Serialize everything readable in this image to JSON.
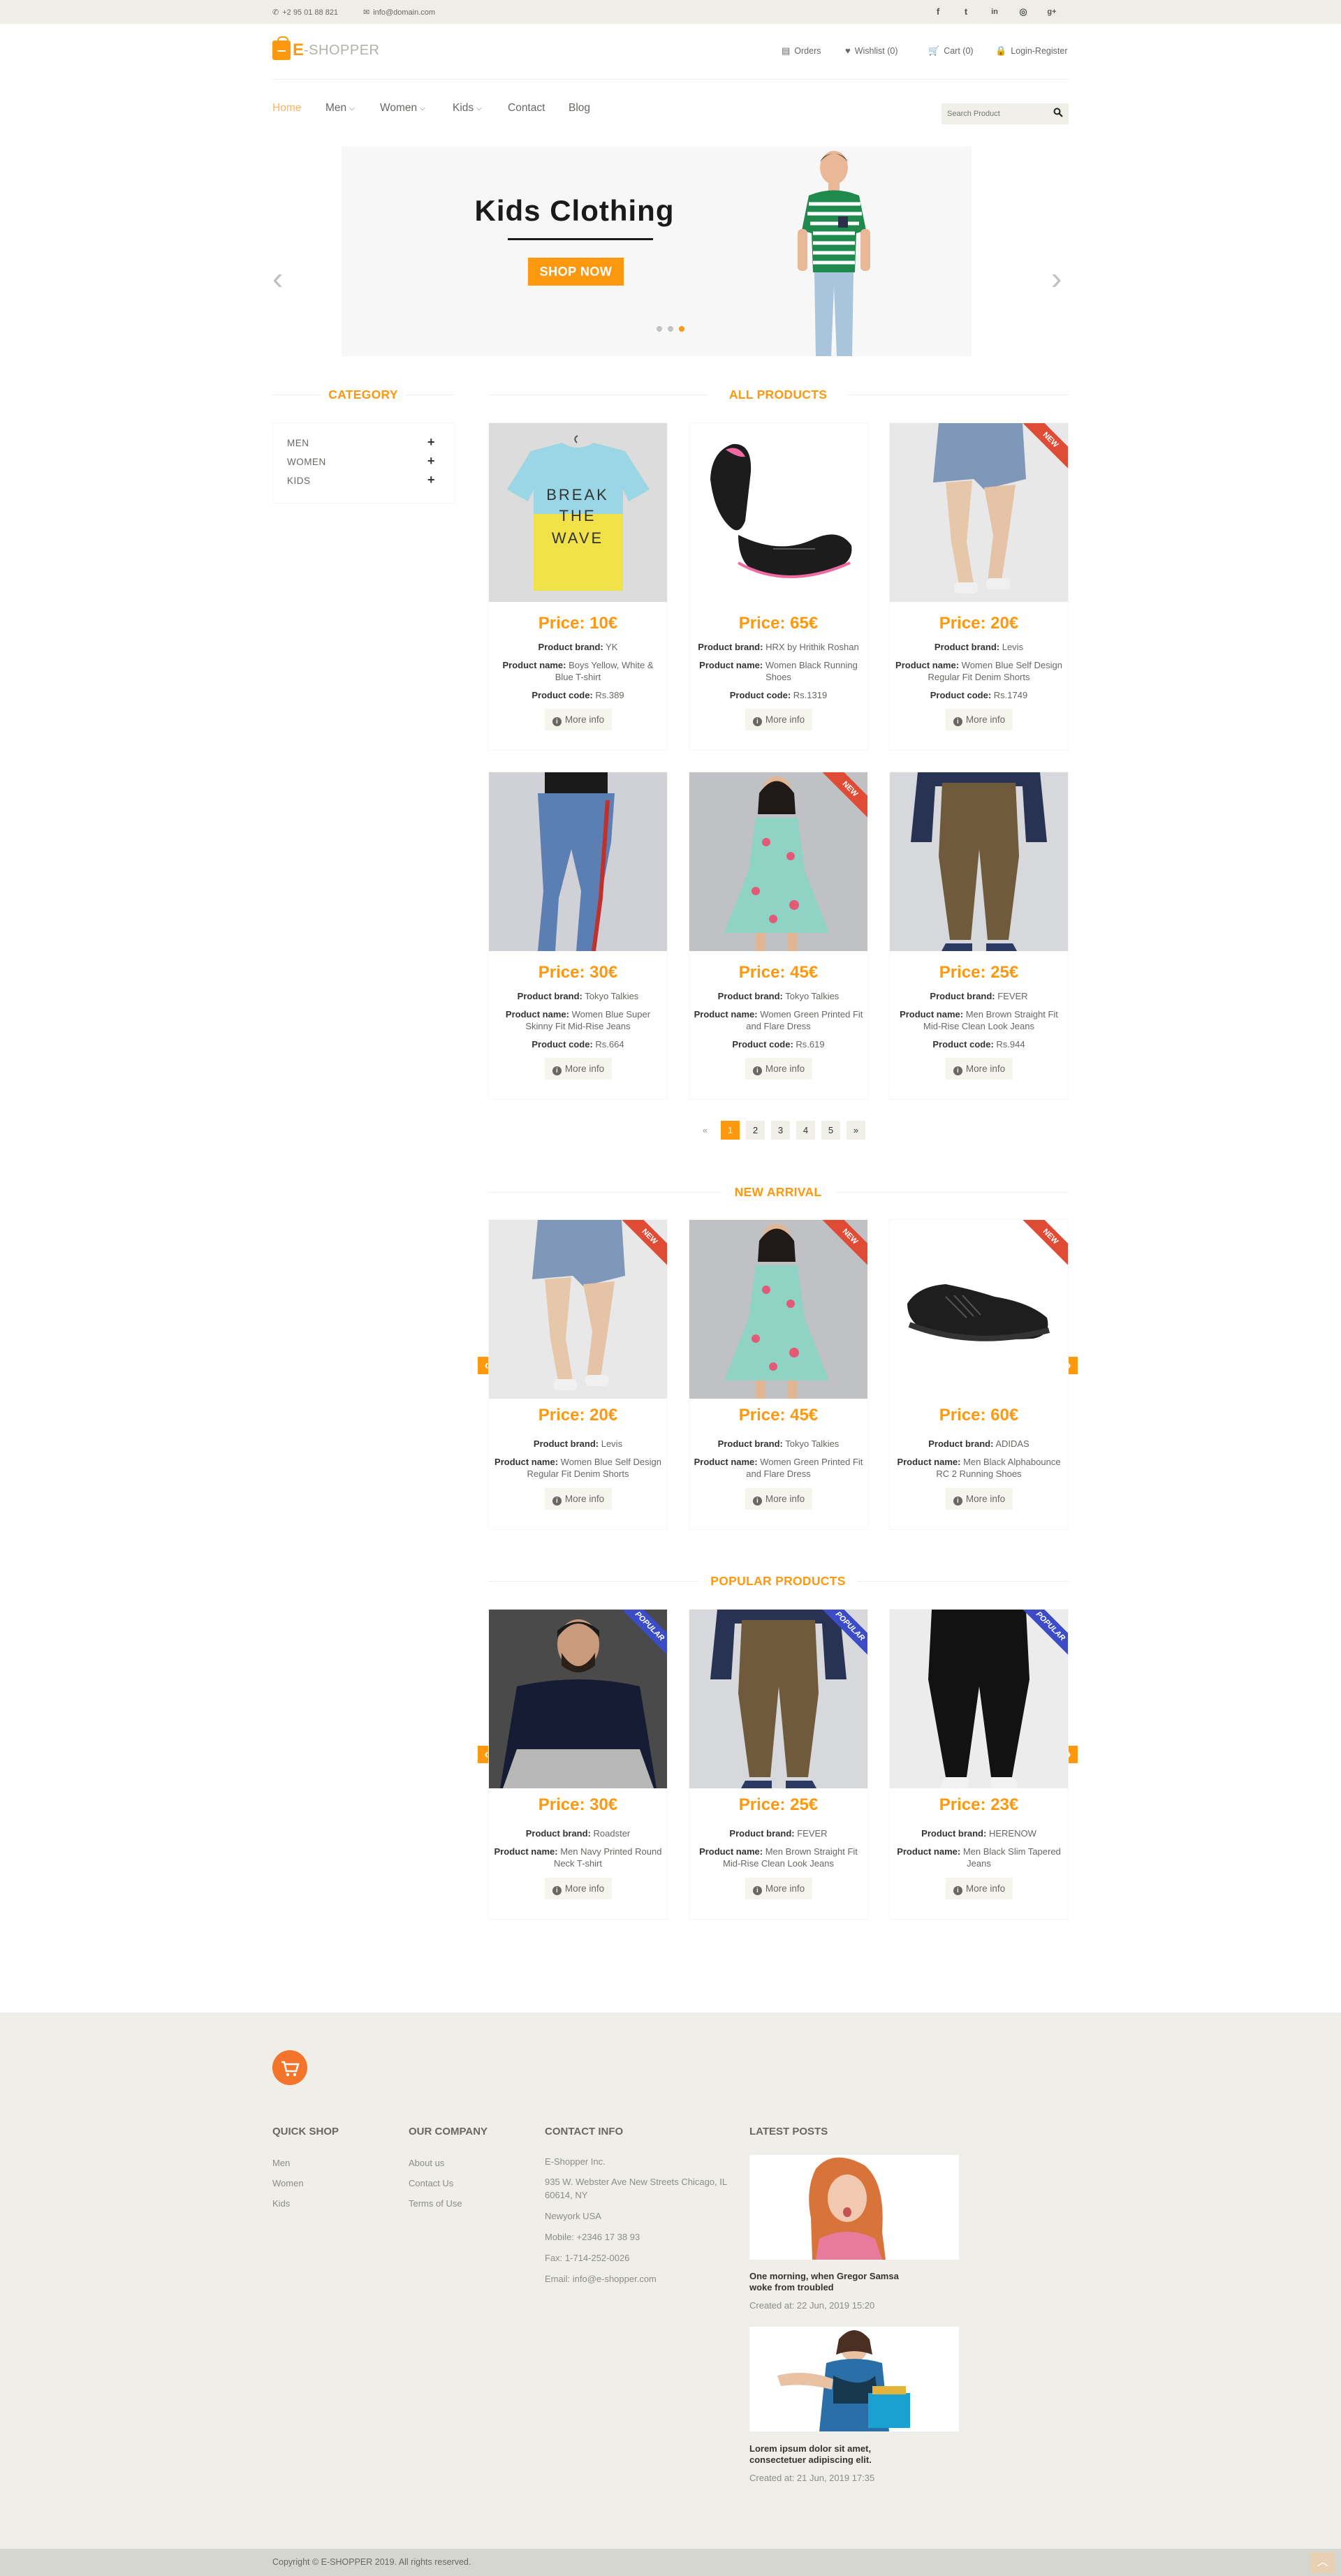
{
  "topbar": {
    "phone": "+2 95 01 88 821",
    "email": "info@domain.com",
    "social": [
      "f",
      "t",
      "in",
      "◎",
      "g+"
    ]
  },
  "header": {
    "logo_e": "E",
    "logo_rest": "-SHOPPER",
    "links": [
      "Orders",
      "Wishlist (0)",
      "Cart (0)",
      "Login-Register"
    ]
  },
  "nav": {
    "items": [
      "Home",
      "Men",
      "Women",
      "Kids",
      "Contact",
      "Blog"
    ],
    "search_placeholder": "Search Product"
  },
  "slider": {
    "title": "Kids Clothing",
    "button": "SHOP NOW",
    "active_slide": 3,
    "slide_count": 3
  },
  "category": {
    "title": "CATEGORY",
    "items": [
      "MEN",
      "WOMEN",
      "KIDS"
    ]
  },
  "labels": {
    "brand": "Product brand:",
    "name": "Product name:",
    "code": "Product code:",
    "more": "More info"
  },
  "all_products": {
    "title": "ALL PRODUCTS",
    "items": [
      {
        "price": "Price: 10€",
        "brand": "YK",
        "name": "Boys Yellow, White & Blue T-shirt",
        "code": "Rs.389",
        "ribbon": ""
      },
      {
        "price": "Price: 65€",
        "brand": "HRX by Hrithik Roshan",
        "name": "Women Black Running Shoes",
        "code": "Rs.1319",
        "ribbon": ""
      },
      {
        "price": "Price: 20€",
        "brand": "Levis",
        "name": "Women Blue Self Design Regular Fit Denim Shorts",
        "code": "Rs.1749",
        "ribbon": "NEW"
      },
      {
        "price": "Price: 30€",
        "brand": "Tokyo Talkies",
        "name": "Women Blue Super Skinny Fit Mid-Rise Jeans",
        "code": "Rs.664",
        "ribbon": ""
      },
      {
        "price": "Price: 45€",
        "brand": "Tokyo Talkies",
        "name": "Women Green Printed Fit and Flare Dress",
        "code": "Rs.619",
        "ribbon": "NEW"
      },
      {
        "price": "Price: 25€",
        "brand": "FEVER",
        "name": "Men Brown Straight Fit Mid-Rise Clean Look Jeans",
        "code": "Rs.944",
        "ribbon": ""
      }
    ]
  },
  "pagination": [
    "«",
    "1",
    "2",
    "3",
    "4",
    "5",
    "»"
  ],
  "new_arrival": {
    "title": "NEW ARRIVAL",
    "items": [
      {
        "price": "Price: 20€",
        "brand": "Levis",
        "name": "Women Blue Self Design Regular Fit Denim Shorts",
        "ribbon": "NEW"
      },
      {
        "price": "Price: 45€",
        "brand": "Tokyo Talkies",
        "name": "Women Green Printed Fit and Flare Dress",
        "ribbon": "NEW"
      },
      {
        "price": "Price: 60€",
        "brand": "ADIDAS",
        "name": "Men Black Alphabounce RC 2 Running Shoes",
        "ribbon": "NEW"
      }
    ]
  },
  "popular": {
    "title": "POPULAR PRODUCTS",
    "items": [
      {
        "price": "Price: 30€",
        "brand": "Roadster",
        "name": "Men Navy Printed Round Neck T-shirt",
        "ribbon": "POPULAR"
      },
      {
        "price": "Price: 25€",
        "brand": "FEVER",
        "name": "Men Brown Straight Fit Mid-Rise Clean Look Jeans",
        "ribbon": "POPULAR"
      },
      {
        "price": "Price: 23€",
        "brand": "HERENOW",
        "name": "Men Black Slim Tapered Jeans",
        "ribbon": "POPULAR"
      }
    ]
  },
  "footer": {
    "quick_shop": {
      "title": "QUICK SHOP",
      "links": [
        "Men",
        "Women",
        "Kids"
      ]
    },
    "our_company": {
      "title": "OUR COMPANY",
      "links": [
        "About us",
        "Contact Us",
        "Terms of Use"
      ]
    },
    "contact": {
      "title": "CONTACT INFO",
      "company": "E-Shopper Inc.",
      "address": "935 W. Webster Ave New Streets Chicago, IL 60614, NY",
      "city": "Newyork USA",
      "mobile": "Mobile: +2346 17 38 93",
      "fax": "Fax: 1-714-252-0026",
      "email": "Email: info@e-shopper.com"
    },
    "latest_posts": {
      "title": "LATEST POSTS",
      "posts": [
        {
          "title": "One morning, when Gregor Samsa woke from troubled",
          "date": "Created at: 22 Jun, 2019 15:20"
        },
        {
          "title": "Lorem ipsum dolor sit amet, consectetuer adipiscing elit.",
          "date": "Created at: 21 Jun, 2019 17:35"
        }
      ]
    },
    "copyright": "Copyright © E-SHOPPER 2019. All rights reserved."
  },
  "colors": {
    "accent": "#FE980F",
    "new_ribbon": "#E04B36",
    "popular_ribbon": "#3B4CC6",
    "footer_bg": "#EFEEE8"
  }
}
